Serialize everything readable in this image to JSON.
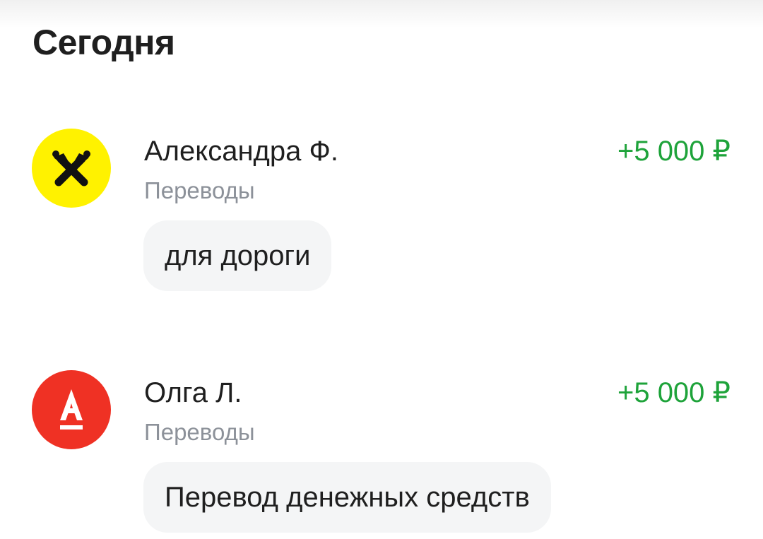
{
  "section": {
    "title": "Сегодня"
  },
  "transactions": [
    {
      "bank_icon": "raiffeisen-bank-icon",
      "avatar_color": "#FFF200",
      "name": "Александра Ф.",
      "category": "Переводы",
      "amount": "+5 000 ₽",
      "comment": "для дороги"
    },
    {
      "bank_icon": "alfa-bank-icon",
      "avatar_color": "#EF3124",
      "name": "Олга Л.",
      "category": "Переводы",
      "amount": "+5 000 ₽",
      "comment": "Перевод денежных средств"
    }
  ],
  "colors": {
    "amount_positive": "#1EA33A",
    "secondary_text": "#8C9199",
    "comment_bg": "#F4F5F6"
  }
}
